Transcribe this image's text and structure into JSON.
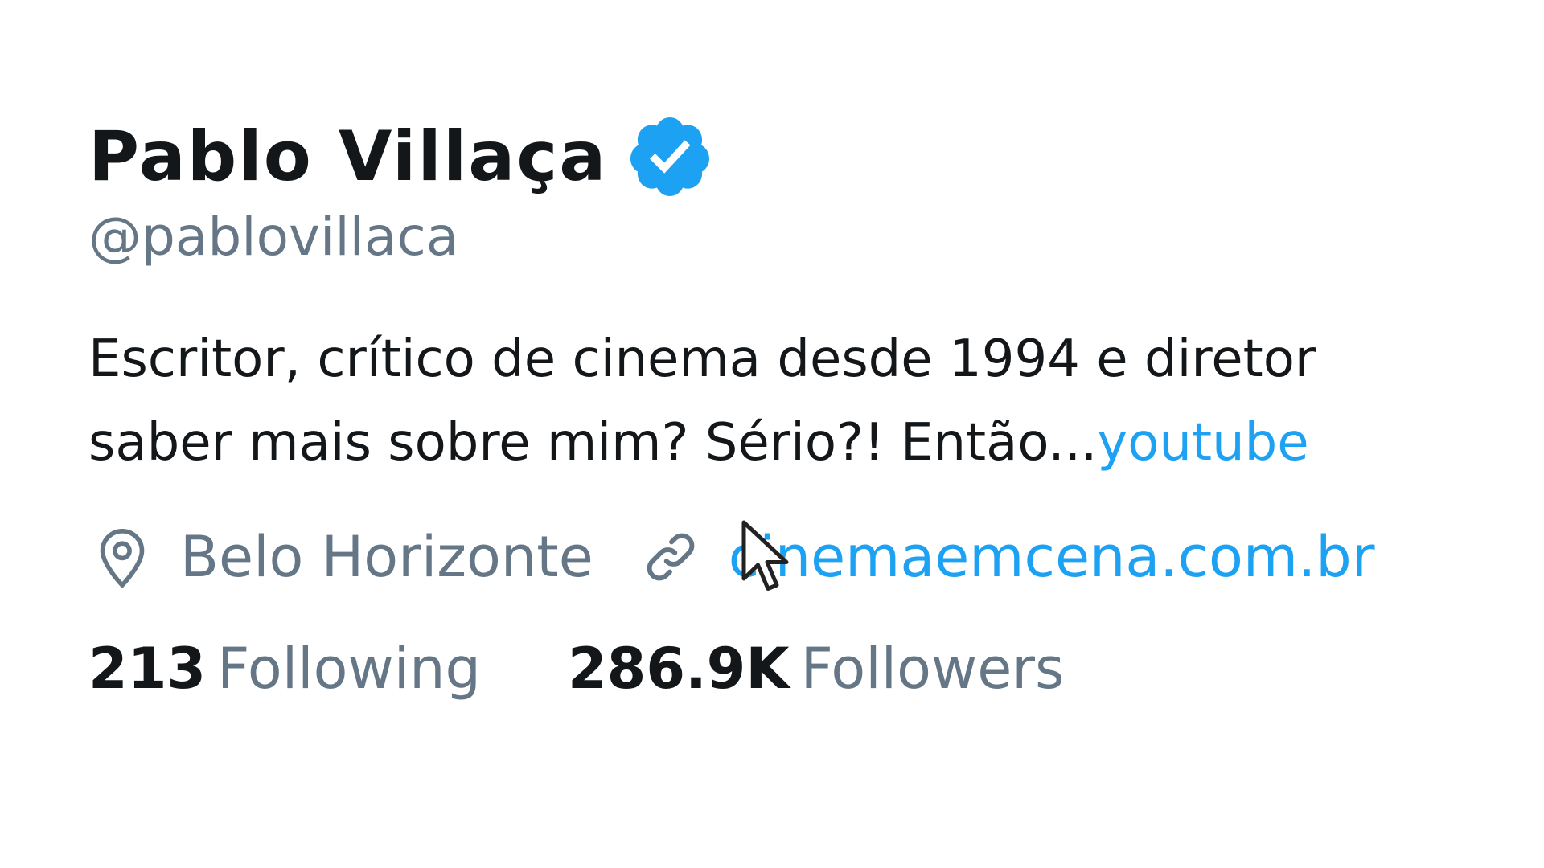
{
  "profile": {
    "display_name": "Pablo Villaça",
    "verified_icon": "verified-badge-icon",
    "handle": "@pablovillaca",
    "bio_line1": "Escritor, crítico de cinema desde 1994 e diretor",
    "bio_line2_text": "saber mais sobre mim? Sério?!  Então...",
    "bio_line2_link": "youtube",
    "location_icon": "location-pin-icon",
    "location": "Belo Horizonte",
    "website_icon": "link-icon",
    "website": "cinemaemcena.com.br",
    "following_count": "213",
    "following_label": "Following",
    "followers_count": "286.9K",
    "followers_label": "Followers"
  },
  "colors": {
    "text_primary": "#14171a",
    "text_secondary": "#657786",
    "accent": "#1da1f2"
  }
}
